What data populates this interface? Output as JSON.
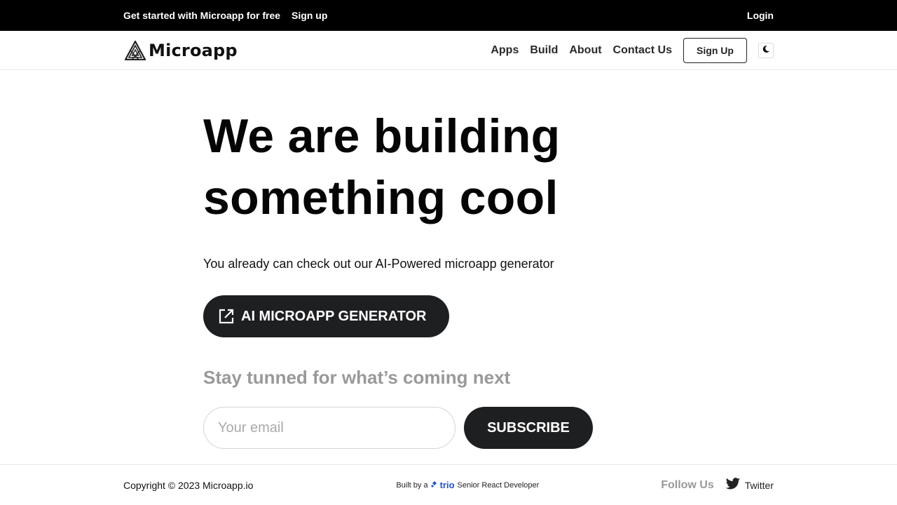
{
  "topbar": {
    "promo_text": "Get started with Microapp for free",
    "signup_link": "Sign up",
    "login_link": "Login"
  },
  "navbar": {
    "brand_name": "Microapp",
    "links": [
      {
        "label": "Apps"
      },
      {
        "label": "Build"
      },
      {
        "label": "About"
      },
      {
        "label": "Contact Us"
      }
    ],
    "signup_button": "Sign Up",
    "theme_toggle_icon": "moon-icon"
  },
  "hero": {
    "title_line1": "We are building",
    "title_line2": "something cool",
    "subtitle": "You already can check out our AI-Powered microapp generator",
    "cta_label": "AI MICROAPP GENERATOR",
    "cta_icon": "external-link-icon"
  },
  "newsletter": {
    "heading": "Stay tunned for what’s coming next",
    "email_placeholder": "Your email",
    "email_value": "",
    "subscribe_label": "SUBSCRIBE"
  },
  "footer": {
    "copyright": "Copyright © 2023 Microapp.io",
    "built_by_prefix": "Built by a",
    "built_by_brand": "trio",
    "built_by_suffix": "Senior React Developer",
    "follow_label": "Follow Us",
    "twitter_label": "Twitter"
  },
  "colors": {
    "topbar_bg": "#000000",
    "button_dark": "#1e1f21",
    "muted_text": "#999999",
    "trio_blue": "#1d4fd8"
  }
}
